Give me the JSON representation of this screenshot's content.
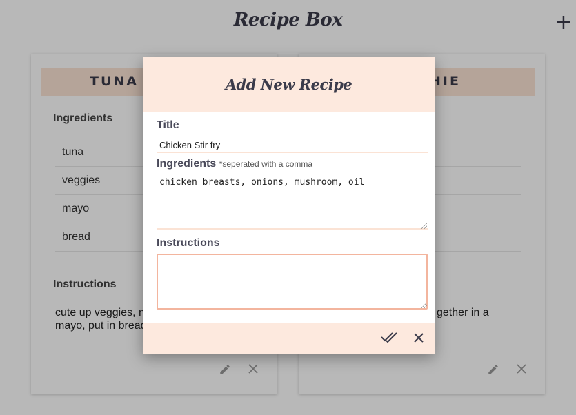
{
  "app": {
    "title": "Recipe Box",
    "add_icon": "+"
  },
  "cards": [
    {
      "title": "TUNA S",
      "ingredients_label": "Ingredients",
      "ingredients": [
        "tuna",
        "veggies",
        "mayo",
        "bread"
      ],
      "instructions_label": "Instructions",
      "instructions_line1": "cute up veggies, m",
      "instructions_line2": "mayo, put in bread"
    },
    {
      "title": "HIE",
      "instructions_fragment": "gether in a"
    }
  ],
  "modal": {
    "title": "Add New Recipe",
    "title_label": "Title",
    "title_value": "Chicken Stir fry",
    "ingredients_label": "Ingredients",
    "ingredients_hint": "*seperated with a comma",
    "ingredients_value": "chicken breasts, onions, mushroom, oil",
    "instructions_label": "Instructions",
    "instructions_value": ""
  },
  "icons": {
    "edit": "pencil-icon",
    "delete": "close-icon",
    "save": "double-check-icon",
    "cancel": "close-icon"
  },
  "colors": {
    "accent_bg": "#fde9de",
    "card_header_bg": "#fbe3d5",
    "focus_border": "#f3b59e",
    "title_text": "#3b3b4a"
  }
}
